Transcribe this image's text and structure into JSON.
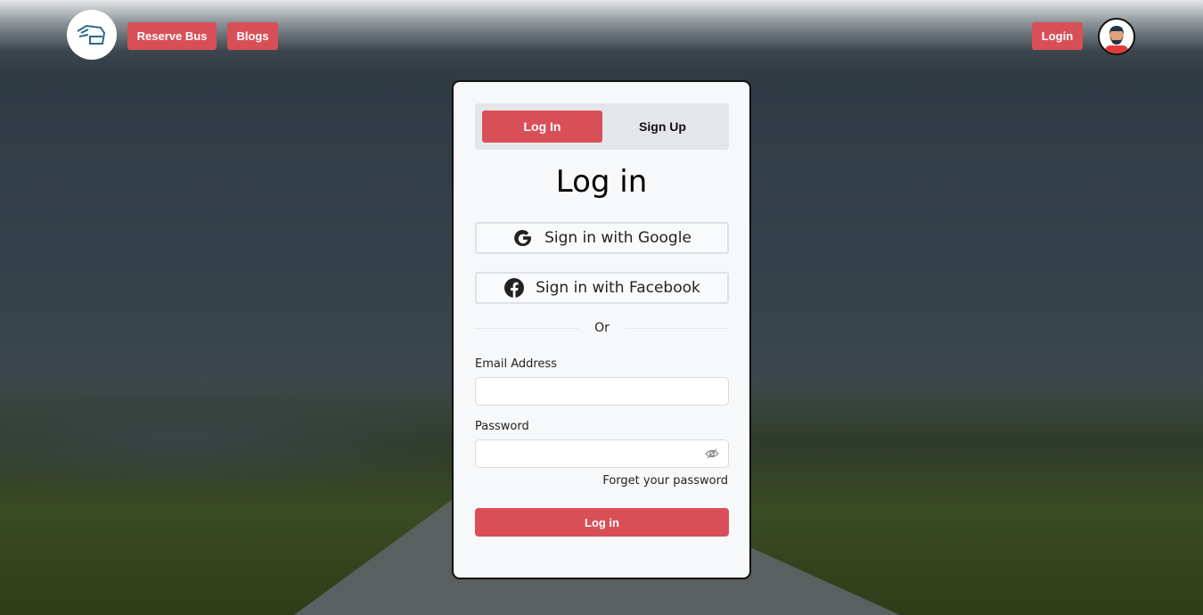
{
  "nav": {
    "reserve_bus": "Reserve Bus",
    "blogs": "Blogs",
    "login": "Login"
  },
  "auth": {
    "tabs": [
      {
        "label": "Log In",
        "active": true
      },
      {
        "label": "Sign Up",
        "active": false
      }
    ],
    "title": "Log in",
    "google": "Sign in with Google",
    "facebook": "Sign in with Facebook",
    "divider": "Or",
    "email_label": "Email Address",
    "email_value": "",
    "password_label": "Password",
    "password_value": "",
    "forgot": "Forget your password",
    "submit": "Log in"
  },
  "colors": {
    "accent": "#d94f57"
  }
}
